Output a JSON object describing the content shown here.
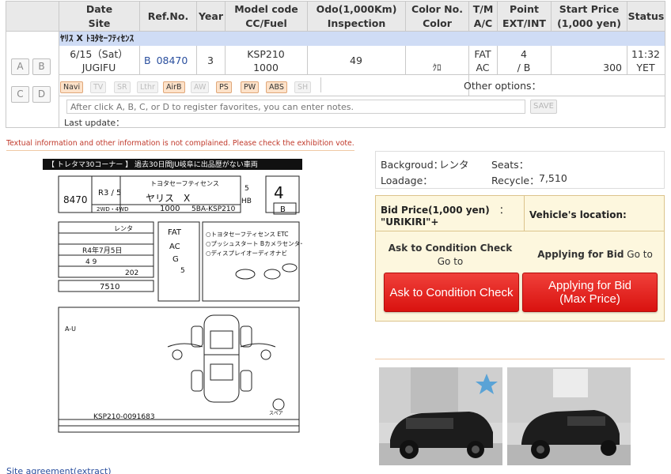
{
  "table_headers": {
    "date_site": [
      "Date",
      "Site"
    ],
    "ref": [
      "Ref.No."
    ],
    "year": [
      "Year"
    ],
    "model": [
      "Model code",
      "CC/Fuel"
    ],
    "odo": [
      "Odo(1,000Km)",
      "Inspection"
    ],
    "color": [
      "Color No.",
      "Color"
    ],
    "tm": [
      "T/M",
      "A/C"
    ],
    "point": [
      "Point",
      "EXT/INT"
    ],
    "price": [
      "Start Price",
      "(1,000 yen)"
    ],
    "status": [
      "Status"
    ]
  },
  "listing": {
    "title": "ﾔﾘｽ X ﾄﾖﾀｾｰﾌﾃｨｾﾝｽ",
    "date": "6/15（Sat）",
    "site": "JUGIFU",
    "ref_prefix": "B",
    "ref_number": "08470",
    "year": "3",
    "model_code": "KSP210",
    "cc": "1000",
    "odo": "49",
    "color": "ｸﾛ",
    "tm": "FAT",
    "ac": "AC",
    "point_ext": "4",
    "point_int": "/ B",
    "start_price": "300",
    "time": "11:32",
    "status": "YET"
  },
  "favorite_buttons": [
    "A",
    "B",
    "C",
    "D"
  ],
  "options": [
    {
      "label": "Navi",
      "on": true
    },
    {
      "label": "TV",
      "on": false
    },
    {
      "label": "SR",
      "on": false
    },
    {
      "label": "Lthr",
      "on": false
    },
    {
      "label": "AirB",
      "on": true
    },
    {
      "label": "AW",
      "on": false
    },
    {
      "label": "PS",
      "on": true
    },
    {
      "label": "PW",
      "on": true
    },
    {
      "label": "ABS",
      "on": true
    },
    {
      "label": "SH",
      "on": false
    }
  ],
  "other_options_label": "Other options：",
  "notes_placeholder": "After click A, B, C, or D to register favorites, you can enter notes.",
  "save_label": "SAVE",
  "last_update_label": "Last update：",
  "warning_text": "Textual information and other information is not complained. Please check the exhibition vote.",
  "sheet": {
    "header": "【 トレタマ30コーナー 】 過去30日間JU岐阜に出品歴がない車両",
    "lot": "8470",
    "year_mark": "R3 / 5",
    "model_name": "ヤリス　X",
    "grade": "トヨタセーフティセンス",
    "cc": "1000",
    "code": "5BA-KSP210",
    "score": "4",
    "interior": "B",
    "door": "5",
    "body": "HB",
    "drive": "2WD・4WD",
    "inspection": "R4年7月5日",
    "seats": "5",
    "recycle": "7510",
    "shift": "FAT",
    "aircon": "AC",
    "color_code": "202",
    "color_name": "G",
    "points": [
      "○トヨタセーフティセンス ETC",
      "○プッシュスタート Bカメラセンター",
      "○ディスプレイオーディオナビ"
    ],
    "serial": "KSP210-0091683",
    "km": "4 9",
    "history": "レンタ",
    "spare": "スペア"
  },
  "info": {
    "background_label": "Backgroud：",
    "background_value": "レンタ",
    "seats_label": "Seats：",
    "seats_value": "",
    "loadage_label": "Loadage：",
    "loadage_value": "",
    "recycle_label": "Recycle：",
    "recycle_value": "7,510"
  },
  "bid": {
    "price_label": "Bid Price(1,000 yen)",
    "price_sep": "：",
    "price_value": "\"URIKIRI\"+",
    "location_label": "Vehicle's location:",
    "ask_text": "Ask to Condition Check",
    "ask_go": "Go to",
    "apply_text": "Applying for Bid",
    "apply_go": "Go to",
    "ask_button": "Ask to Condition Check",
    "apply_button_line1": "Applying for Bid",
    "apply_button_line2": "(Max Price)"
  },
  "footer_link": "Site agreement(extract)",
  "colors": {
    "header_bg": "#e9e9e9",
    "title_bar": "#cfdcf5",
    "bid_bg": "#fdf7de",
    "red_button": "#e3201c",
    "warning": "#c0392b",
    "link": "#2a4f9e"
  }
}
